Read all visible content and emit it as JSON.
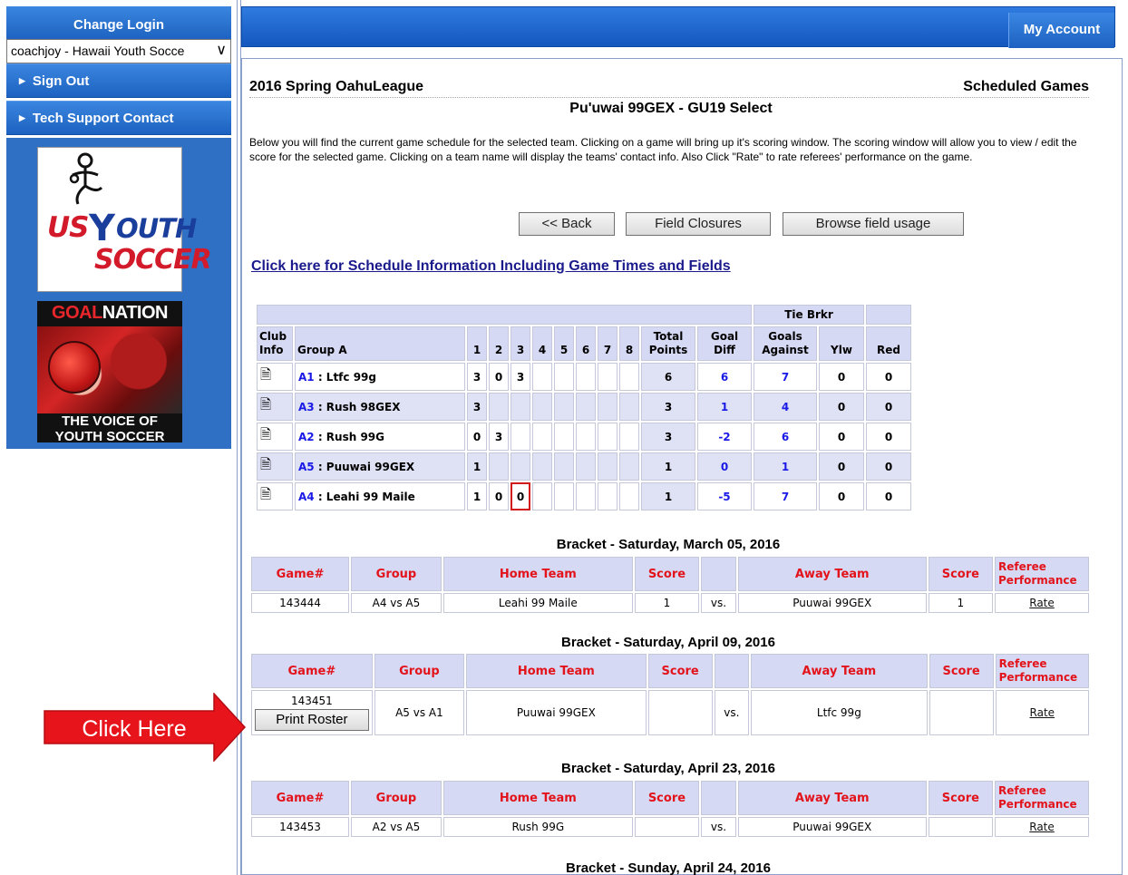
{
  "sidebar": {
    "change_login": "Change Login",
    "account_select": "coachjoy - Hawaii Youth Socce",
    "sign_out": "Sign Out",
    "tech_support": "Tech Support Contact",
    "logo1": {
      "line1": "US",
      "line2": "OUTH",
      "line3": "SOCCER"
    },
    "logo2": {
      "goal": "GOAL",
      "nation": "NATION",
      "tag1": "THE VOICE OF",
      "tag2": "YOUTH SOCCER"
    }
  },
  "topbar": {
    "my_account": "My Account"
  },
  "header": {
    "league": "2016 Spring OahuLeague",
    "section": "Scheduled Games",
    "team": "Pu'uwai 99GEX - GU19 Select",
    "intro": "Below you will find the current game schedule for the selected team. Clicking on a game will bring up it's scoring window. The scoring window will allow you to view / edit the score for the selected game. Clicking on a team name will display the teams' contact info. Also Click \"Rate\" to rate referees' performance on the game."
  },
  "buttons": {
    "back": "<< Back",
    "closures": "Field Closures",
    "usage": "Browse field usage"
  },
  "schedule_link": "Click here for Schedule Information Including Game Times and Fields",
  "standings": {
    "tie_brkr": "Tie Brkr",
    "club": "Club",
    "info": "Info",
    "group": "Group A",
    "rounds": [
      "1",
      "2",
      "3",
      "4",
      "5",
      "6",
      "7",
      "8"
    ],
    "total_a": "Total",
    "total_b": "Points",
    "gd_a": "Goal",
    "gd_b": "Diff",
    "ga_a": "Goals",
    "ga_b": "Against",
    "ylw": "Ylw",
    "red": "Red",
    "rows": [
      {
        "code": "A1",
        "name": " : Ltfc 99g",
        "r": [
          "3",
          "0",
          "3",
          "",
          "",
          "",
          "",
          ""
        ],
        "pts": "6",
        "gd": "6",
        "ga": "7",
        "y": "0",
        "rd": "0"
      },
      {
        "code": "A3",
        "name": " : Rush 98GEX",
        "r": [
          "3",
          "",
          "",
          "",
          "",
          "",
          "",
          ""
        ],
        "pts": "3",
        "gd": "1",
        "ga": "4",
        "y": "0",
        "rd": "0"
      },
      {
        "code": "A2",
        "name": " : Rush 99G",
        "r": [
          "0",
          "3",
          "",
          "",
          "",
          "",
          "",
          ""
        ],
        "pts": "3",
        "gd": "-2",
        "ga": "6",
        "y": "0",
        "rd": "0"
      },
      {
        "code": "A5",
        "name": " : Puuwai 99GEX",
        "r": [
          "1",
          "",
          "",
          "",
          "",
          "",
          "",
          ""
        ],
        "pts": "1",
        "gd": "0",
        "ga": "1",
        "y": "0",
        "rd": "0"
      },
      {
        "code": "A4",
        "name": " : Leahi 99 Maile",
        "r": [
          "1",
          "0",
          "0",
          "",
          "",
          "",
          "",
          ""
        ],
        "pts": "1",
        "gd": "-5",
        "ga": "7",
        "y": "0",
        "rd": "0"
      }
    ]
  },
  "bracket_cols": {
    "game": "Game#",
    "group": "Group",
    "home": "Home Team",
    "score": "Score",
    "away": "Away Team",
    "ref1": "Referee",
    "ref2": "Performance"
  },
  "brackets": [
    {
      "title": "Bracket  - Saturday, March 05, 2016",
      "game": "143444",
      "group": "A4 vs A5",
      "home": "Leahi 99 Maile",
      "hs": "1",
      "vs": "vs.",
      "away": "Puuwai 99GEX",
      "as": "1",
      "rate": "Rate"
    },
    {
      "title": "Bracket  - Saturday, April 09, 2016",
      "game": "143451",
      "print": "Print Roster",
      "group": "A5 vs A1",
      "home": "Puuwai 99GEX",
      "hs": "",
      "vs": "vs.",
      "away": "Ltfc 99g",
      "as": "",
      "rate": "Rate"
    },
    {
      "title": "Bracket  - Saturday, April 23, 2016",
      "game": "143453",
      "group": "A2 vs A5",
      "home": "Rush 99G",
      "hs": "",
      "vs": "vs.",
      "away": "Puuwai 99GEX",
      "as": "",
      "rate": "Rate"
    },
    {
      "title": "Bracket  - Sunday, April 24, 2016"
    }
  ],
  "annotation": {
    "label": "Click Here",
    "color": "#e8141b"
  }
}
